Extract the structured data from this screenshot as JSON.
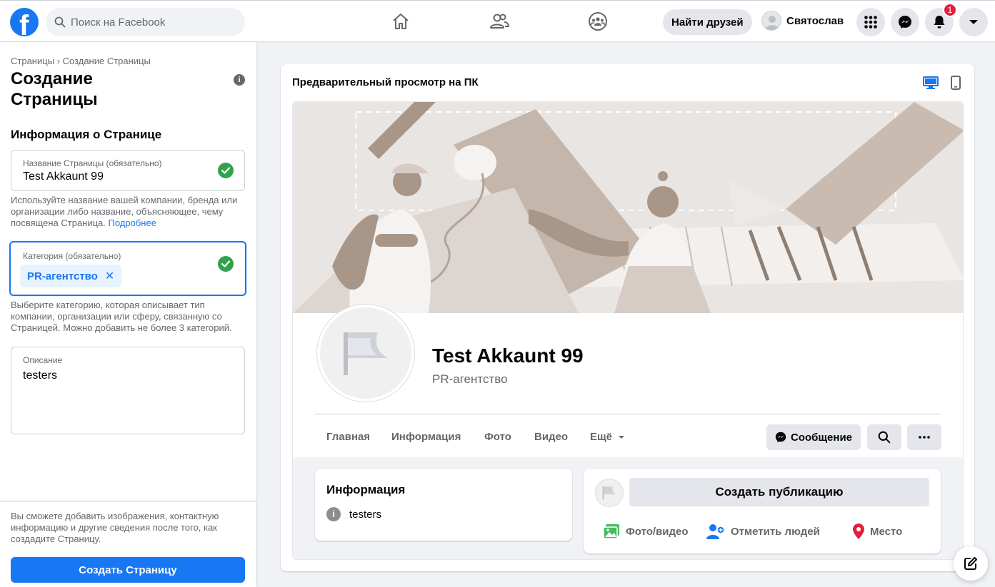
{
  "topbar": {
    "search_placeholder": "Поиск на Facebook",
    "find_friends_label": "Найти друзей",
    "profile_name": "Святослав",
    "notification_count": "1"
  },
  "left_panel": {
    "breadcrumb": "Страницы › Создание Страницы",
    "title": "Создание Страницы",
    "section_title": "Информация о Странице",
    "name_field": {
      "label": "Название Страницы (обязательно)",
      "value": "Test Akkaunt 99",
      "helper": "Используйте название вашей компании, бренда или организации либо название, объясняющее, чему посвящена Страница.",
      "helper_link": "Подробнее"
    },
    "category_field": {
      "label": "Категория (обязательно)",
      "chip": "PR-агентство",
      "helper": "Выберите категорию, которая описывает тип компании, организации или сферу, связанную со Страницей. Можно добавить не более 3 категорий."
    },
    "description_field": {
      "label": "Описание",
      "value": "testers"
    },
    "footer_note": "Вы сможете добавить изображения, контактную информацию и другие сведения после того, как создадите Страницу.",
    "create_button": "Создать Страницу"
  },
  "preview": {
    "title": "Предварительный просмотр на ПК",
    "page_name": "Test Akkaunt 99",
    "page_category": "PR-агентство",
    "tabs": [
      "Главная",
      "Информация",
      "Фото",
      "Видео",
      "Ещё"
    ],
    "message_button": "Сообщение",
    "info_card": {
      "title": "Информация",
      "description": "testers"
    },
    "composer": {
      "create_post": "Создать публикацию",
      "photo_video": "Фото/видео",
      "tag_people": "Отметить людей",
      "place": "Место"
    }
  },
  "colors": {
    "brand": "#1877f2",
    "success": "#31a24c",
    "badge": "#e41e3f",
    "place_icon": "#e41e3f",
    "photo_icon": "#45bd62"
  }
}
